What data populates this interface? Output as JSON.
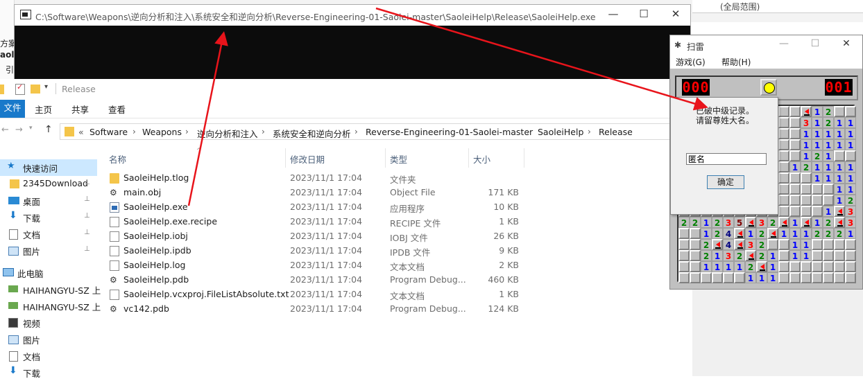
{
  "console": {
    "title": "C:\\Software\\Weapons\\逆向分析和注入\\系统安全和逆向分析\\Reverse-Engineering-01-Saolei-master\\SaoleiHelp\\Release\\SaoleiHelp.exe",
    "minimize": "—",
    "maximize": "☐",
    "close": "✕"
  },
  "background": {
    "left_fragments": [
      "方案",
      "aol",
      "引"
    ],
    "right_fragment": "(全局范围)"
  },
  "explorer": {
    "quick_title": "Release",
    "ribbon_tabs": [
      "文件",
      "主页",
      "共享",
      "查看"
    ],
    "breadcrumb": [
      "Software",
      "Weapons",
      "逆向分析和注入",
      "系统安全和逆向分析",
      "Reverse-Engineering-01-Saolei-master",
      "SaoleiHelp",
      "Release"
    ],
    "breadcrumb_prefix": "«",
    "nav_items": [
      {
        "label": "快速访问",
        "icon": "star-icon",
        "pin": ""
      },
      {
        "label": "2345Download",
        "icon": "folder-icon",
        "pin": "📌"
      },
      {
        "label": "桌面",
        "icon": "desktop-icon",
        "pin": "📌"
      },
      {
        "label": "下载",
        "icon": "download-icon",
        "pin": "📌"
      },
      {
        "label": "文档",
        "icon": "document-icon",
        "pin": "📌"
      },
      {
        "label": "图片",
        "icon": "picture-icon",
        "pin": "📌"
      },
      {
        "label": "此电脑",
        "icon": "computer-icon",
        "pin": ""
      },
      {
        "label": "HAIHANGYU-SZ 上",
        "icon": "network-drive-icon",
        "pin": ""
      },
      {
        "label": "HAIHANGYU-SZ 上",
        "icon": "network-drive-icon",
        "pin": ""
      },
      {
        "label": "视频",
        "icon": "video-icon",
        "pin": ""
      },
      {
        "label": "图片",
        "icon": "picture-icon",
        "pin": ""
      },
      {
        "label": "文档",
        "icon": "document-icon",
        "pin": ""
      },
      {
        "label": "下载",
        "icon": "download-icon",
        "pin": ""
      }
    ],
    "columns": {
      "name": "名称",
      "date": "修改日期",
      "type": "类型",
      "size": "大小"
    },
    "files": [
      {
        "name": "SaoleiHelp.tlog",
        "date": "2023/11/1 17:04",
        "type": "文件夹",
        "size": "",
        "icon": "folder"
      },
      {
        "name": "main.obj",
        "date": "2023/11/1 17:04",
        "type": "Object File",
        "size": "171 KB",
        "icon": "obj"
      },
      {
        "name": "SaoleiHelp.exe",
        "date": "2023/11/1 17:04",
        "type": "应用程序",
        "size": "10 KB",
        "icon": "exe"
      },
      {
        "name": "SaoleiHelp.exe.recipe",
        "date": "2023/11/1 17:04",
        "type": "RECIPE 文件",
        "size": "1 KB",
        "icon": "doc"
      },
      {
        "name": "SaoleiHelp.iobj",
        "date": "2023/11/1 17:04",
        "type": "IOBJ 文件",
        "size": "26 KB",
        "icon": "doc"
      },
      {
        "name": "SaoleiHelp.ipdb",
        "date": "2023/11/1 17:04",
        "type": "IPDB 文件",
        "size": "9 KB",
        "icon": "doc"
      },
      {
        "name": "SaoleiHelp.log",
        "date": "2023/11/1 17:04",
        "type": "文本文档",
        "size": "2 KB",
        "icon": "doc"
      },
      {
        "name": "SaoleiHelp.pdb",
        "date": "2023/11/1 17:04",
        "type": "Program Debug...",
        "size": "460 KB",
        "icon": "pdb"
      },
      {
        "name": "SaoleiHelp.vcxproj.FileListAbsolute.txt",
        "date": "2023/11/1 17:04",
        "type": "文本文档",
        "size": "1 KB",
        "icon": "doc"
      },
      {
        "name": "vc142.pdb",
        "date": "2023/11/1 17:04",
        "type": "Program Debug...",
        "size": "124 KB",
        "icon": "pdb"
      }
    ]
  },
  "minesweeper": {
    "title": "扫雷",
    "menu": [
      "游戏(G)",
      "帮助(H)"
    ],
    "mine_counter": "000",
    "timer": "001",
    "board": [
      "...........F12..",
      "...........312111",
      "...........11111",
      "...........11111",
      "...........121..",
      "..........1211111",
      "............1111",
      "..............11",
      "..............121",
      ".............1F31",
      "221235F32F1F12F31",
      "..124F12F11122211",
      "..2F4F32..11....",
      "..2132F21.11....",
      "..11112F1.......",
      "......111......."
    ]
  },
  "dialog": {
    "line1": "已破中级记录。",
    "line2": "请留尊姓大名。",
    "name_value": "匿名",
    "ok_label": "确定"
  },
  "colors": {
    "accent": "#1979ca",
    "console_bg": "#0c0c0c",
    "arrow": "#e8141b",
    "minesweeper_gray": "#c0c0c0"
  }
}
